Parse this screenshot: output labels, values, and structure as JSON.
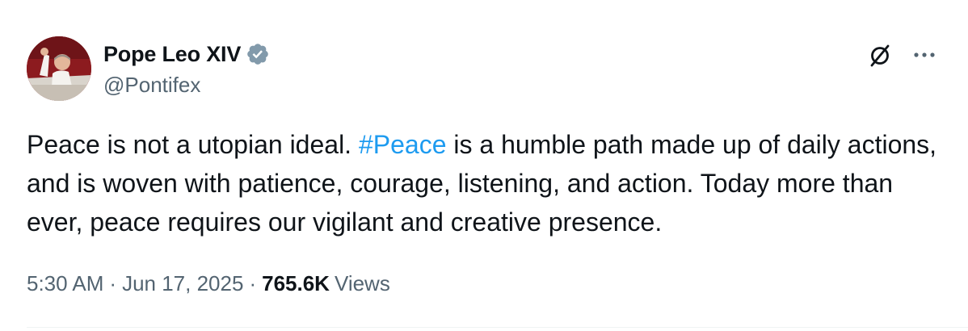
{
  "author": {
    "display_name": "Pope Leo XIV",
    "handle": "@Pontifex",
    "verified": true
  },
  "post": {
    "text_before": "Peace is not a utopian ideal. ",
    "hashtag": "#Peace",
    "text_after": " is a humble path made up of daily actions, and is woven with patience, courage, listening, and action. Today more than ever, peace requires our vigilant and creative presence."
  },
  "meta": {
    "time": "5:30 AM",
    "separator": "·",
    "date": "Jun 17, 2025",
    "views_count": "765.6K",
    "views_label": "Views"
  },
  "icons": {
    "verified": "verified-badge-icon",
    "grok": "grok-icon",
    "more": "more-options-icon"
  },
  "colors": {
    "hashtag": "#1d9bf0",
    "secondary_text": "#536471",
    "primary_text": "#0f1419",
    "verified_badge": "#829aab"
  }
}
